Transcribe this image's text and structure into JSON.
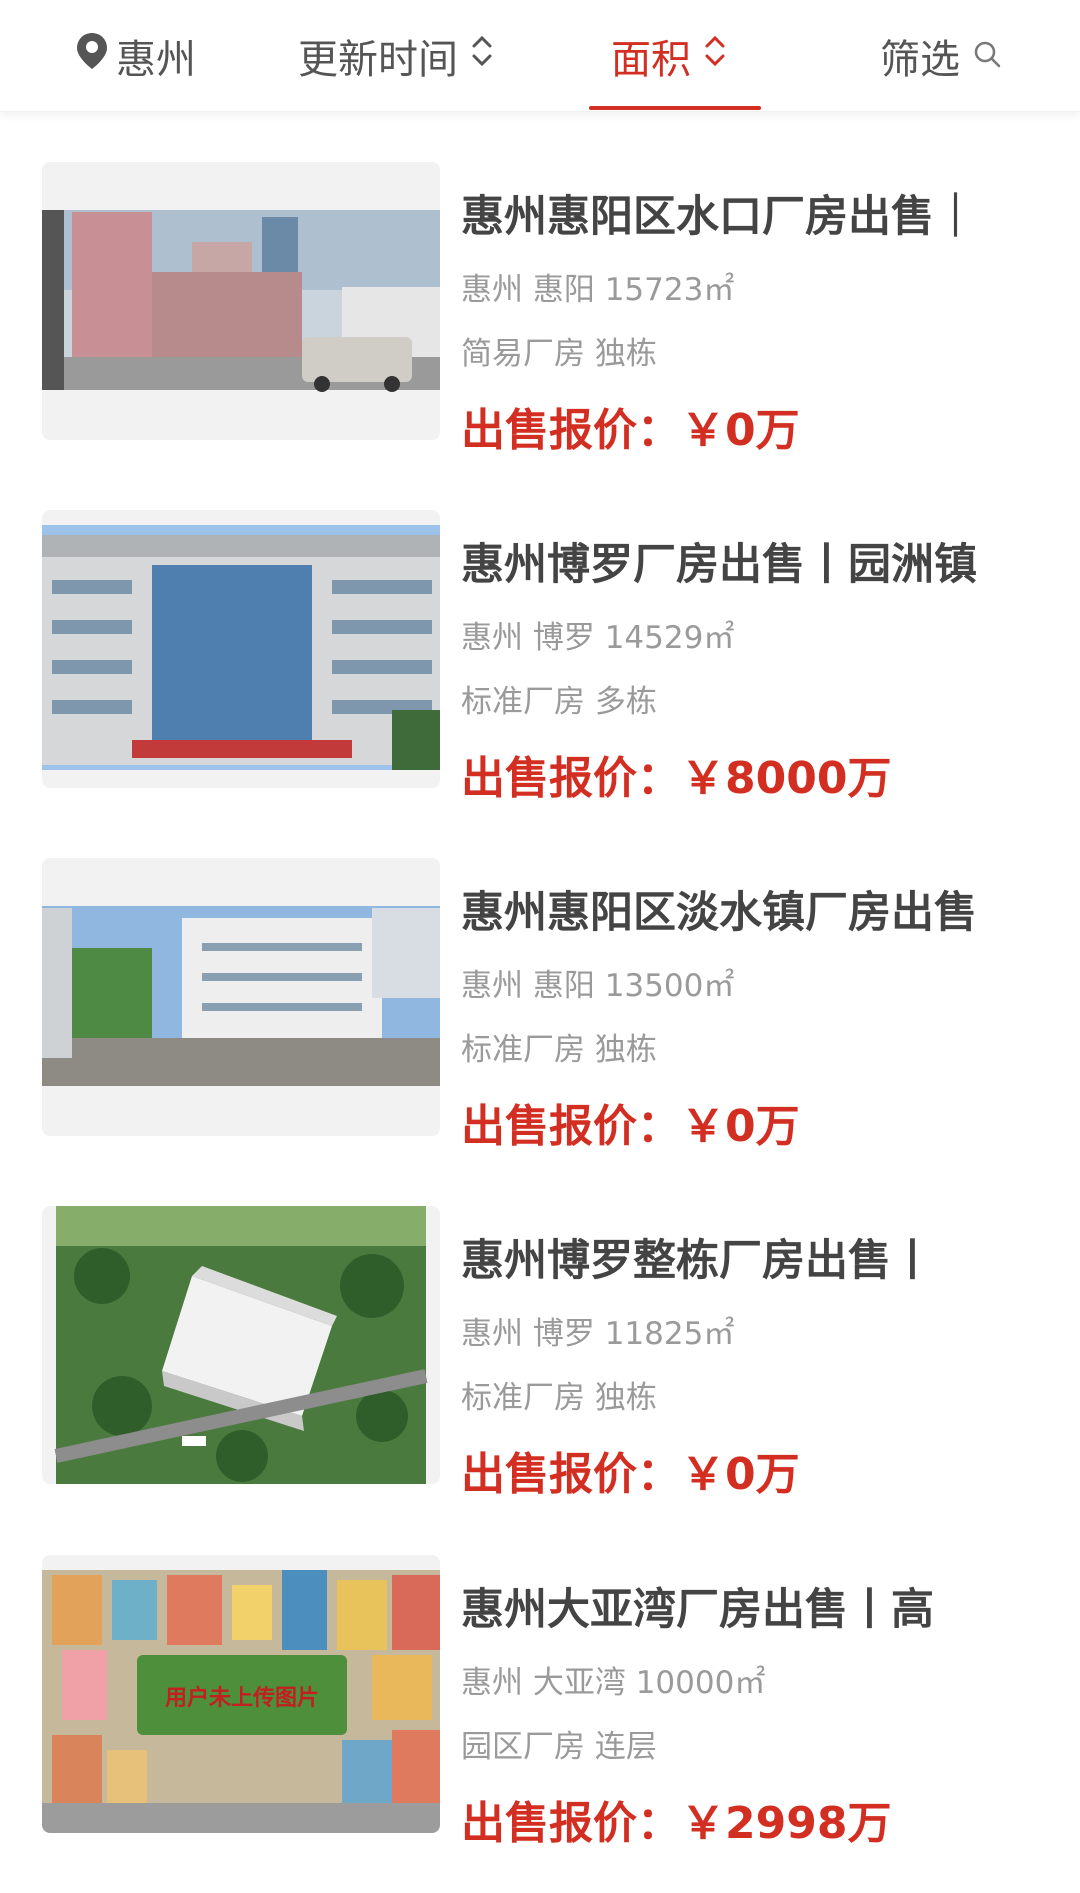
{
  "filter_bar": {
    "city": "惠州",
    "update_time": "更新时间",
    "area": "面积",
    "filter": "筛选",
    "active_color": "#d22f22"
  },
  "listings": [
    {
      "title": "惠州惠阳区水口厂房出售｜",
      "location": "惠州 惠阳 15723㎡",
      "tags": "简易厂房 独栋",
      "price_label": "出售报价：",
      "price": "￥0万"
    },
    {
      "title": "惠州博罗厂房出售丨园洲镇",
      "location": "惠州 博罗 14529㎡",
      "tags": "标准厂房 多栋",
      "price_label": "出售报价：",
      "price": "￥8000万"
    },
    {
      "title": "惠州惠阳区淡水镇厂房出售",
      "location": "惠州 惠阳 13500㎡",
      "tags": "标准厂房 独栋",
      "price_label": "出售报价：",
      "price": "￥0万"
    },
    {
      "title": "惠州博罗整栋厂房出售丨",
      "location": "惠州 博罗 11825㎡",
      "tags": "标准厂房 独栋",
      "price_label": "出售报价：",
      "price": "￥0万"
    },
    {
      "title": "惠州大亚湾厂房出售丨高",
      "location": "惠州 大亚湾 10000㎡",
      "tags": "园区厂房 连层",
      "price_label": "出售报价：",
      "price": "￥2998万",
      "image_overlay_text": "用户未上传图片"
    }
  ]
}
